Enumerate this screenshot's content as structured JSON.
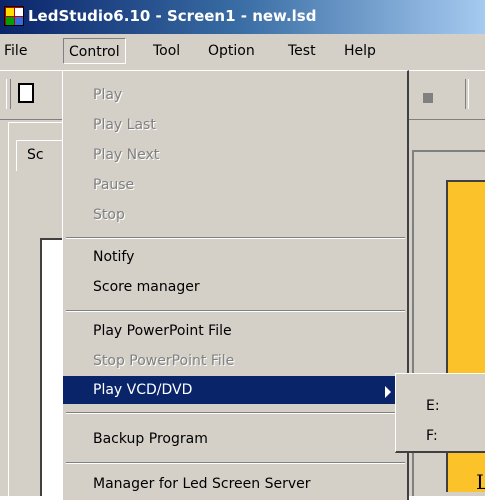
{
  "window": {
    "title": "LedStudio6.10 - Screen1 - new.lsd"
  },
  "menubar": {
    "items": [
      "File",
      "Control",
      "Tool",
      "Option",
      "Test",
      "Help"
    ],
    "active": "Control"
  },
  "left_tab": {
    "label": "Sc"
  },
  "control_menu": {
    "items": [
      {
        "label": "Play",
        "enabled": false
      },
      {
        "label": "Play Last",
        "enabled": false
      },
      {
        "label": "Play Next",
        "enabled": false
      },
      {
        "label": "Pause",
        "enabled": false
      },
      {
        "label": "Stop",
        "enabled": false
      },
      {
        "label": "Notify",
        "enabled": true
      },
      {
        "label": "Score manager",
        "enabled": true
      },
      {
        "label": "Play PowerPoint File",
        "enabled": true
      },
      {
        "label": "Stop PowerPoint File",
        "enabled": false
      },
      {
        "label": "Play VCD/DVD",
        "enabled": true,
        "highlighted": true,
        "submenu": true
      },
      {
        "label": "Backup Program",
        "enabled": true
      },
      {
        "label": "Manager for Led Screen Server",
        "enabled": true
      }
    ]
  },
  "submenu": {
    "items": [
      "E:",
      "F:"
    ]
  },
  "overflow_text": "L",
  "colors": {
    "highlight": "#0a246a",
    "panel": "#d4d0c8",
    "preview": "#fcc22a"
  }
}
